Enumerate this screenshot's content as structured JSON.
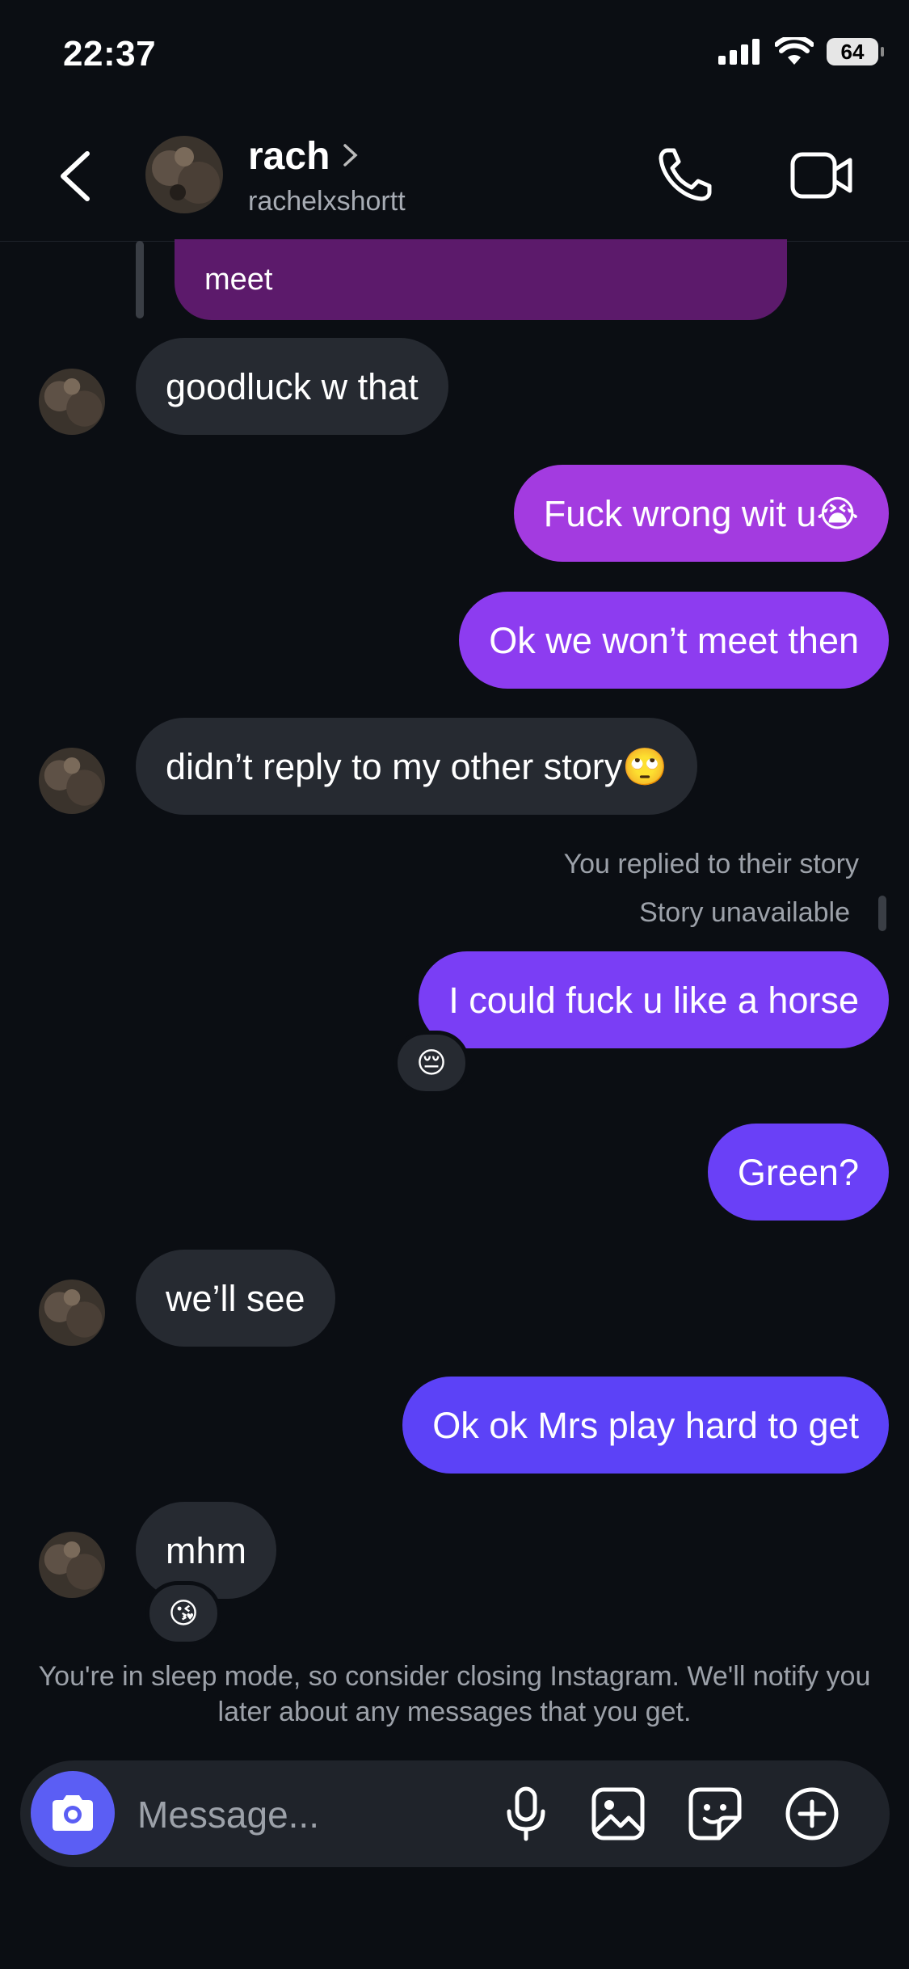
{
  "status_bar": {
    "time": "22:37",
    "battery": "64"
  },
  "header": {
    "name": "rach",
    "username": "rachelxshortt"
  },
  "messages": [
    {
      "side": "sent",
      "text": "meet",
      "color": "#5c1a6b"
    },
    {
      "side": "received",
      "text": "goodluck w that"
    },
    {
      "side": "sent",
      "text": "Fuck wrong wit u😭",
      "color": "#a33be0"
    },
    {
      "side": "sent",
      "text": "Ok we won’t meet then",
      "color": "#8d3cf0"
    },
    {
      "side": "received",
      "text": "didn’t reply to my other story🙄"
    },
    {
      "side": "sent",
      "text": "I could fuck u like a horse",
      "color": "#7a3ef5",
      "reaction": "😔"
    },
    {
      "side": "sent",
      "text": "Green?",
      "color": "#6a40f7"
    },
    {
      "side": "received",
      "text": "we’ll see"
    },
    {
      "side": "sent",
      "text": "Ok ok Mrs play hard to get",
      "color": "#5c42f7"
    },
    {
      "side": "received",
      "text": "mhm",
      "reaction": "😘"
    }
  ],
  "story_reply": {
    "label": "You replied to their story",
    "status": "Story unavailable"
  },
  "sleep_notice": "You're in sleep mode, so consider closing Instagram. We'll notify you later about any messages that you get.",
  "composer": {
    "placeholder": "Message..."
  },
  "colors": {
    "background": "#0b0e13",
    "received_bubble": "#262a31",
    "camera_button": "#5b5ef4"
  },
  "icons": [
    "back-icon",
    "chevron-right-icon",
    "phone-icon",
    "video-call-icon",
    "camera-icon",
    "microphone-icon",
    "gallery-icon",
    "sticker-icon",
    "plus-icon"
  ]
}
